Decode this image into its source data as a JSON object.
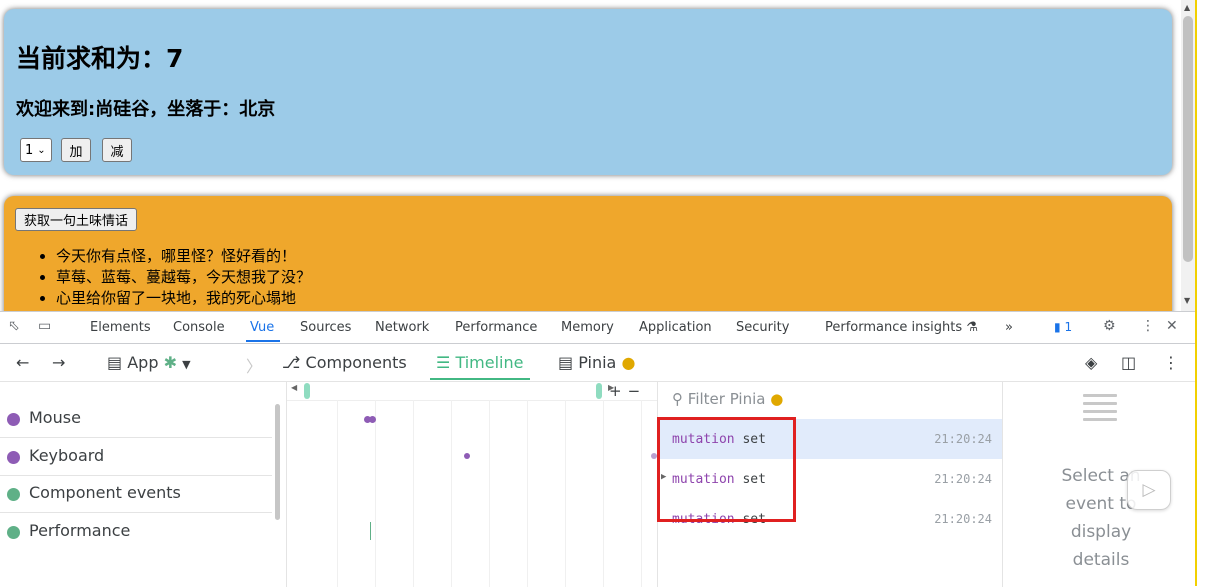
{
  "page": {
    "sum_card": {
      "title": "当前求和为：7",
      "welcome": "欢迎来到:尚硅谷，坐落于：北京",
      "select_value": "1",
      "add_label": "加",
      "subtract_label": "减",
      "background": "#9ccbe8"
    },
    "talk_card": {
      "fetch_button_label": "获取一句土味情话",
      "items": [
        "今天你有点怪，哪里怪？怪好看的！",
        "草莓、蓝莓、蔓越莓，今天想我了没？",
        "心里给你留了一块地，我的死心塌地"
      ],
      "background": "#efa72c"
    }
  },
  "devtools": {
    "tabs": [
      "Elements",
      "Console",
      "Vue",
      "Sources",
      "Network",
      "Performance",
      "Memory",
      "Application",
      "Security",
      "Performance insights"
    ],
    "active_tab": "Vue",
    "more_tabs": "»",
    "issues_count": "1",
    "vue": {
      "app_label": "App",
      "nav": {
        "components": "Components",
        "timeline": "Timeline",
        "pinia": "Pinia"
      },
      "active_nav": "Timeline",
      "accent": "#42b883",
      "layers": [
        {
          "label": "Mouse",
          "color": "#8e5cb5"
        },
        {
          "label": "Keyboard",
          "color": "#8e5cb5"
        },
        {
          "label": "Component events",
          "color": "#5fb087"
        },
        {
          "label": "Performance",
          "color": "#5fb087"
        }
      ],
      "filter_placeholder": "Filter Pinia",
      "events": [
        {
          "kind": "mutation",
          "action": "set",
          "time": "21:20:24"
        },
        {
          "kind": "mutation",
          "action": "set",
          "time": "21:20:24"
        },
        {
          "kind": "mutation",
          "action": "set",
          "time": "21:20:24"
        }
      ],
      "details_empty": "Select an event to display details"
    }
  }
}
